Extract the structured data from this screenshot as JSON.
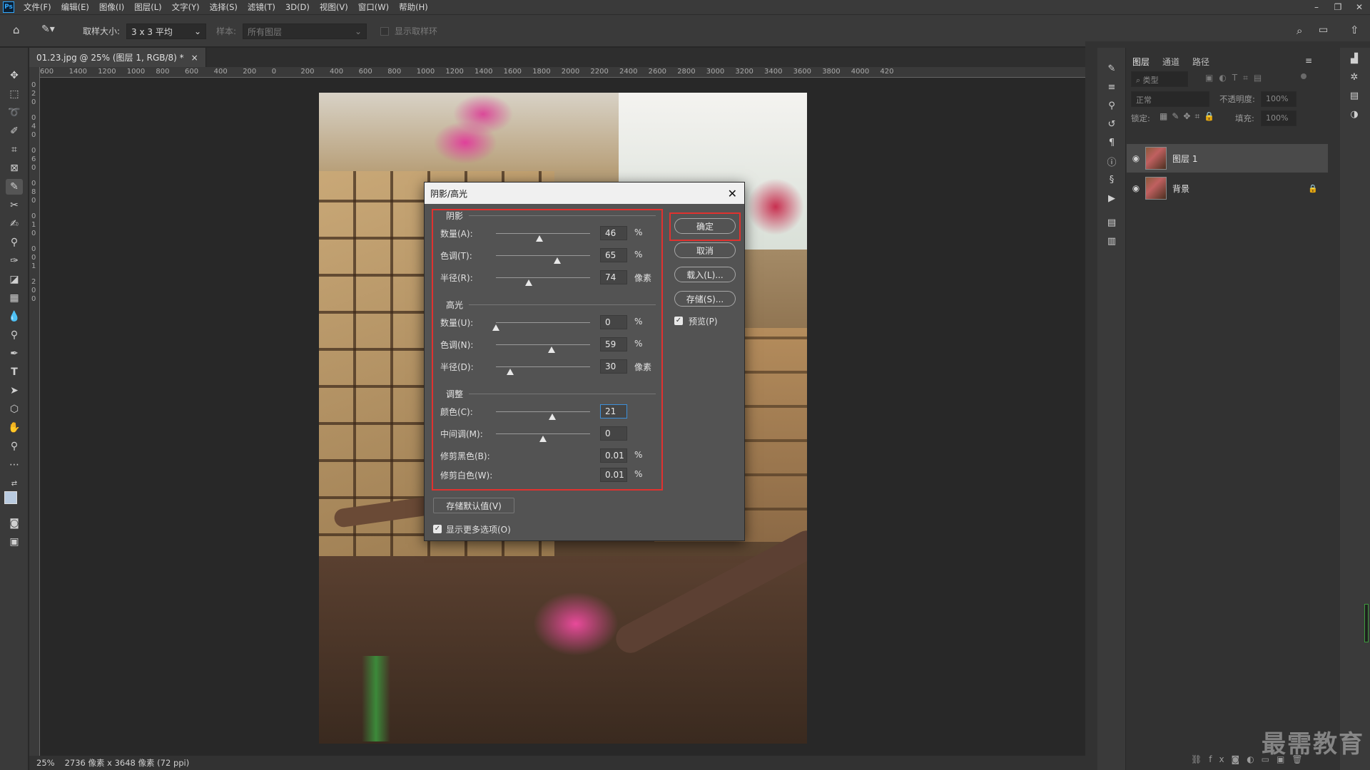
{
  "menubar": {
    "logo": "Ps",
    "items": [
      "文件(F)",
      "编辑(E)",
      "图像(I)",
      "图层(L)",
      "文字(Y)",
      "选择(S)",
      "滤镜(T)",
      "3D(D)",
      "视图(V)",
      "窗口(W)",
      "帮助(H)"
    ],
    "window_buttons": [
      "–",
      "❐",
      "✕"
    ]
  },
  "options": {
    "sample_size_label": "取样大小:",
    "sample_size_value": "3 x 3 平均",
    "sample_label": "样本:",
    "sample_value": "所有图层",
    "show_ring_label": "显示取样环"
  },
  "document": {
    "tab_title": "01.23.jpg @ 25% (图层 1, RGB/8) *",
    "tab_close": "×"
  },
  "ruler": {
    "h_labels": [
      "600",
      "1400",
      "1200",
      "1000",
      "800",
      "600",
      "400",
      "200",
      "0",
      "200",
      "400",
      "600",
      "800",
      "1000",
      "1200",
      "1400",
      "1600",
      "1800",
      "2000",
      "2200",
      "2400",
      "2600",
      "2800",
      "3000",
      "3200",
      "3400",
      "3600",
      "3800",
      "4000",
      "420"
    ],
    "v_labels": [
      "0",
      "2",
      "0",
      "0",
      "4",
      "0",
      "0",
      "6",
      "0",
      "0",
      "8",
      "0",
      "0",
      "1",
      "0",
      "0",
      "0",
      "1",
      "2",
      "0",
      "0"
    ]
  },
  "dialog": {
    "title": "阴影/高光",
    "close": "✕",
    "shadows": {
      "title": "阴影",
      "rows": [
        {
          "label": "数量(A):",
          "value": "46",
          "unit": "%",
          "level": 0.46
        },
        {
          "label": "色调(T):",
          "value": "65",
          "unit": "%",
          "level": 0.65
        },
        {
          "label": "半径(R):",
          "value": "74",
          "unit": "像素",
          "level": 0.35
        }
      ]
    },
    "highlights": {
      "title": "高光",
      "rows": [
        {
          "label": "数量(U):",
          "value": "0",
          "unit": "%",
          "level": 0.0
        },
        {
          "label": "色调(N):",
          "value": "59",
          "unit": "%",
          "level": 0.59
        },
        {
          "label": "半径(D):",
          "value": "30",
          "unit": "像素",
          "level": 0.15
        }
      ]
    },
    "adjustments": {
      "title": "调整",
      "rows": [
        {
          "label": "颜色(C):",
          "value": "21",
          "unit": "",
          "level": 0.6
        },
        {
          "label": "中间调(M):",
          "value": "0",
          "unit": "",
          "level": 0.5
        },
        {
          "label": "修剪黑色(B):",
          "value": "0.01",
          "unit": "%"
        },
        {
          "label": "修剪白色(W):",
          "value": "0.01",
          "unit": "%"
        }
      ]
    },
    "buttons": {
      "ok": "确定",
      "cancel": "取消",
      "load": "载入(L)...",
      "save": "存储(S)...",
      "save_defaults": "存储默认值(V)"
    },
    "preview_label": "预览(P)",
    "more_options_label": "显示更多选项(O)",
    "check_mark": "✓"
  },
  "layers_panel": {
    "tabs": [
      "图层",
      "通道",
      "路径"
    ],
    "filter_placeholder": "类型",
    "blend_mode": "正常",
    "opacity_label": "不透明度:",
    "opacity_value": "100%",
    "lock_label": "锁定:",
    "fill_label": "填充:",
    "fill_value": "100%",
    "layers": [
      {
        "name": "图层 1",
        "selected": true
      },
      {
        "name": "背景",
        "selected": false,
        "locked": true
      }
    ]
  },
  "status": {
    "zoom": "25%",
    "info": "2736 像素 x 3648 像素 (72 ppi)"
  },
  "watermark": "最需教育"
}
